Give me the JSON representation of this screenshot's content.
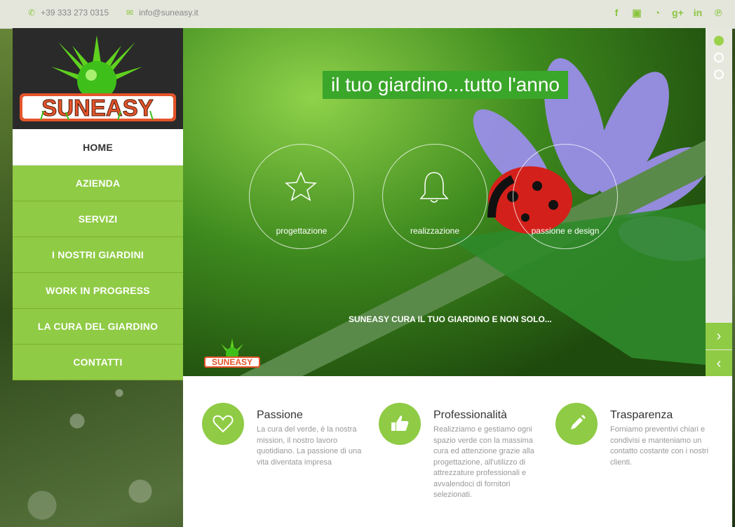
{
  "topbar": {
    "phone": "+39 333 273 0315",
    "email": "info@suneasy.it",
    "social_icons": [
      "facebook-icon",
      "flickr-icon",
      "rss-icon",
      "google-plus-icon",
      "linkedin-icon",
      "pinterest-icon"
    ]
  },
  "brand": {
    "name": "SUNEASY"
  },
  "nav": {
    "items": [
      {
        "label": "HOME"
      },
      {
        "label": "AZIENDA"
      },
      {
        "label": "SERVIZI"
      },
      {
        "label": "I NOSTRI GIARDINI"
      },
      {
        "label": "WORK IN PROGRESS"
      },
      {
        "label": "LA CURA DEL GIARDINO"
      },
      {
        "label": "CONTATTI"
      }
    ]
  },
  "hero": {
    "title": "il tuo giardino...tutto l'anno",
    "circles": [
      {
        "label": "progettazione",
        "icon": "star-icon"
      },
      {
        "label": "realizzazione",
        "icon": "bell-icon"
      },
      {
        "label": "passione e design",
        "icon": "ladybug"
      }
    ],
    "caption": "SUNEASY CURA IL TUO GIARDINO E NON SOLO...",
    "slides_total": 3,
    "active_slide": 1
  },
  "features": [
    {
      "title": "Passione",
      "icon": "heart-icon",
      "text": "La cura del verde, è la nostra mission, il nostro lavoro quotidiano. La passione di una vita diventata impresa"
    },
    {
      "title": "Professionalità",
      "icon": "thumbs-up-icon",
      "text": "Realizziamo e gestiamo ogni spazio verde con la massima cura ed attenzione grazie alla progettazione, all'utilizzo di attrezzature professionali e avvalendoci di fornitori selezionati."
    },
    {
      "title": "Trasparenza",
      "icon": "pencil-icon",
      "text": "Forniamo preventivi chiari e condivisi e manteniamo un contatto costante con i nostri clienti."
    }
  ],
  "colors": {
    "accent": "#8fcb45",
    "hero_title_bg": "#3aa62a",
    "topbar": "#e4e6dc"
  }
}
